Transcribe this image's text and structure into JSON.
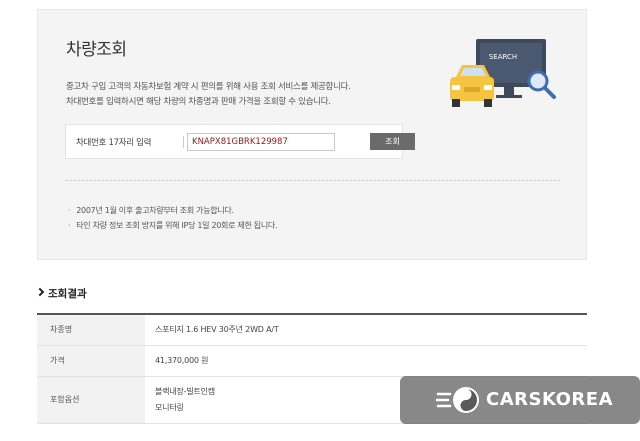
{
  "lookup": {
    "title": "차량조회",
    "description_line1": "중고차 구입 고객의 자동차보험 계약 시 편의를 위해 사용 조회 서비스를 제공합니다.",
    "description_line2": "차대번호를 입력하시면 해당 차량의 차종명과 판매 가격을 조회할 수 있습니다.",
    "illustration_text": "SEARCH",
    "input_label": "차대번호 17자리 입력",
    "vin_value": "KNAPX81GBRK129987",
    "search_button_label": "조회",
    "notes": [
      "2007년 1월 이후 출고차량부터 조회 가능합니다.",
      "타인 차량 정보 조회 방지를 위해 IP당 1일 20회로 제한 됩니다."
    ]
  },
  "result": {
    "title": "조회결과",
    "rows": [
      {
        "label": "차종명",
        "value": "스포티지 1.6 HEV 30주년 2WD A/T"
      },
      {
        "label": "가격",
        "value": "41,370,000 원"
      },
      {
        "label": "포함옵션",
        "value_line1": "블랙내장-빌트인캠",
        "value_line2": "모니터링"
      }
    ]
  },
  "watermark": {
    "text": "CARSKOREA"
  },
  "colors": {
    "panel_bg": "#f4f4f4",
    "vin_text": "#8b1a1a",
    "button_bg": "#6b6b6b",
    "car_yellow": "#f5c542",
    "monitor_dark": "#3d4a5c"
  }
}
